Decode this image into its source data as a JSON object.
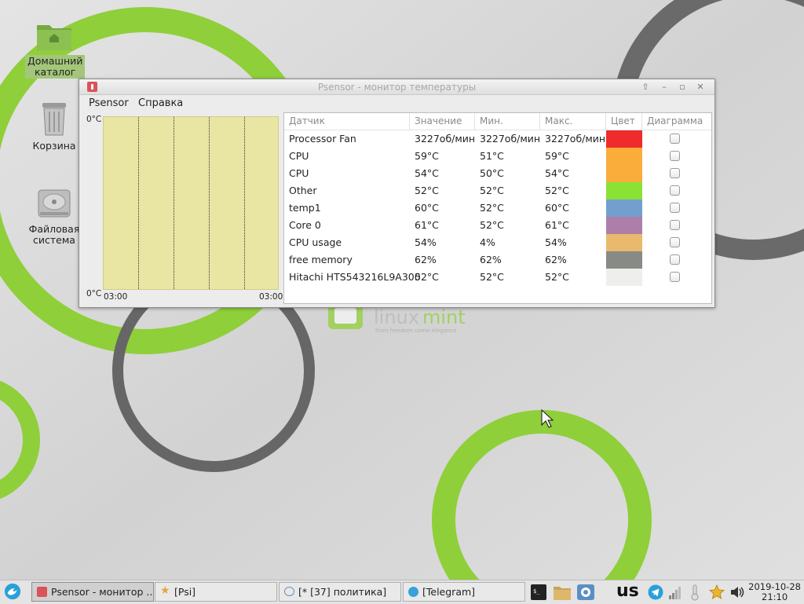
{
  "desktop": {
    "icons": [
      {
        "label_line1": "Домашний",
        "label_line2": "каталог"
      },
      {
        "label_line1": "Корзина",
        "label_line2": ""
      },
      {
        "label_line1": "Файловая",
        "label_line2": "система"
      }
    ],
    "wallpaper_logo": {
      "brand": "linux mint",
      "tagline": "from freedom came elegance"
    }
  },
  "window": {
    "title": "Psensor - монитор температуры",
    "menu": [
      "Psensor",
      "Справка"
    ],
    "controls": [
      "maximize-up-icon",
      "minimize-icon",
      "restore-icon",
      "close-icon"
    ],
    "graph": {
      "y_top": "0°C",
      "y_bottom": "0°C",
      "x_left": "03:00",
      "x_right": "03:00",
      "background": "#e8e6a2"
    },
    "table": {
      "headers": [
        "Датчик",
        "Значение",
        "Мин.",
        "Макс.",
        "Цвет",
        "Диаграмма"
      ],
      "rows": [
        {
          "sensor": "Processor Fan",
          "value": "3227об/мин",
          "min": "3227об/мин",
          "max": "3227об/мин",
          "color": "#ef2b2b",
          "chart": false
        },
        {
          "sensor": "CPU",
          "value": "59°C",
          "min": "51°C",
          "max": "59°C",
          "color": "#fbad3c",
          "chart": false
        },
        {
          "sensor": "CPU",
          "value": "54°C",
          "min": "50°C",
          "max": "54°C",
          "color": "#fbad3c",
          "chart": false
        },
        {
          "sensor": "Other",
          "value": "52°C",
          "min": "52°C",
          "max": "52°C",
          "color": "#8ae234",
          "chart": false
        },
        {
          "sensor": "temp1",
          "value": "60°C",
          "min": "52°C",
          "max": "60°C",
          "color": "#729fcf",
          "chart": false
        },
        {
          "sensor": "Core 0",
          "value": "61°C",
          "min": "52°C",
          "max": "61°C",
          "color": "#ad7fa8",
          "chart": false
        },
        {
          "sensor": "CPU usage",
          "value": "54%",
          "min": "4%",
          "max": "54%",
          "color": "#e9b96e",
          "chart": false
        },
        {
          "sensor": "free memory",
          "value": "62%",
          "min": "62%",
          "max": "62%",
          "color": "#888a85",
          "chart": false
        },
        {
          "sensor": "Hitachi HTS543216L9A300",
          "value": "52°C",
          "min": "52°C",
          "max": "52°C",
          "color": "#eeeeec",
          "chart": false
        }
      ]
    }
  },
  "taskbar": {
    "tasks": [
      {
        "label": "Psensor - монитор ...",
        "icon": "psensor-icon",
        "active": true
      },
      {
        "label": "[Psi]",
        "icon": "psi-star-icon",
        "active": false
      },
      {
        "label": "[* [37] политика]",
        "icon": "chat-bubble-icon",
        "active": false
      },
      {
        "label": "[Telegram]",
        "icon": "telegram-icon",
        "active": false
      }
    ],
    "launchers": [
      "terminal-icon",
      "folder-icon",
      "browser-icon"
    ],
    "keyboard_layout": "us",
    "tray_icons": [
      "telegram-icon",
      "network-signal-icon",
      "thermometer-icon",
      "star-icon",
      "volume-icon"
    ],
    "clock": {
      "date": "2019-10-28",
      "time": "21:10"
    }
  }
}
